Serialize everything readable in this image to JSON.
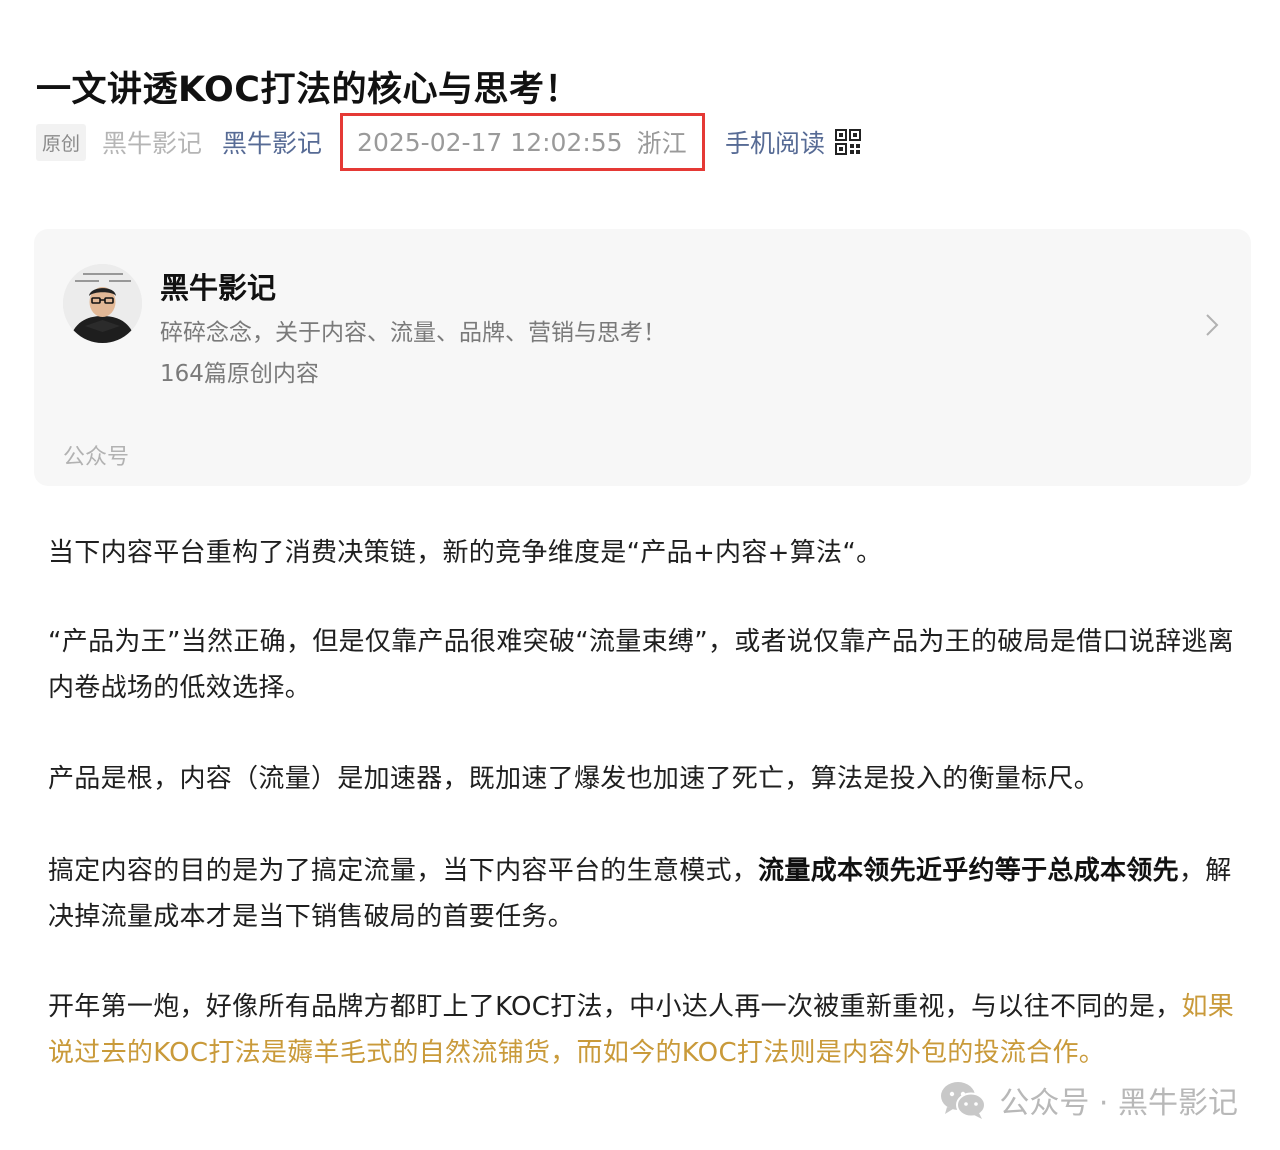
{
  "article": {
    "title": "一文讲透KOC打法的核心与思考！",
    "meta": {
      "original_tag": "原创",
      "author_name": "黑牛影记",
      "account_link": "黑牛影记",
      "datetime": "2025-02-17 12:02:55",
      "location": "浙江",
      "mobile_read": "手机阅读"
    }
  },
  "profile_card": {
    "name": "黑牛影记",
    "description": "碎碎念念，关于内容、流量、品牌、营销与思考！",
    "count": "164篇原创内容",
    "footer": "公众号"
  },
  "content": {
    "p1": "当下内容平台重构了消费决策链，新的竞争维度是“产品+内容+算法“。",
    "p2": "“产品为王”当然正确，但是仅靠产品很难突破“流量束缚”，或者说仅靠产品为王的破局是借口说辞逃离内卷战场的低效选择。",
    "p3": "产品是根，内容（流量）是加速器，既加速了爆发也加速了死亡，算法是投入的衡量标尺。",
    "p4_a": "搞定内容的目的是为了搞定流量，当下内容平台的生意模式，",
    "p4_bold": "流量成本领先近乎约等于总成本领先",
    "p4_b": "，解决掉流量成本才是当下销售破局的首要任务。",
    "p5_a": "开年第一炮，好像所有品牌方都盯上了KOC打法，中小达人再一次被重新重视，与以往不同的是，",
    "p5_highlight": "如果说过去的KOC打法是薅羊毛式的自然流铺货，而如今的KOC打法则是内容外包的投流合作。"
  },
  "watermark": {
    "text": "公众号 · 黑牛影记",
    "icon": "wechat-icon"
  },
  "colors": {
    "link": "#576b95",
    "highlight": "#c99a3a",
    "box_border": "#e53935"
  }
}
